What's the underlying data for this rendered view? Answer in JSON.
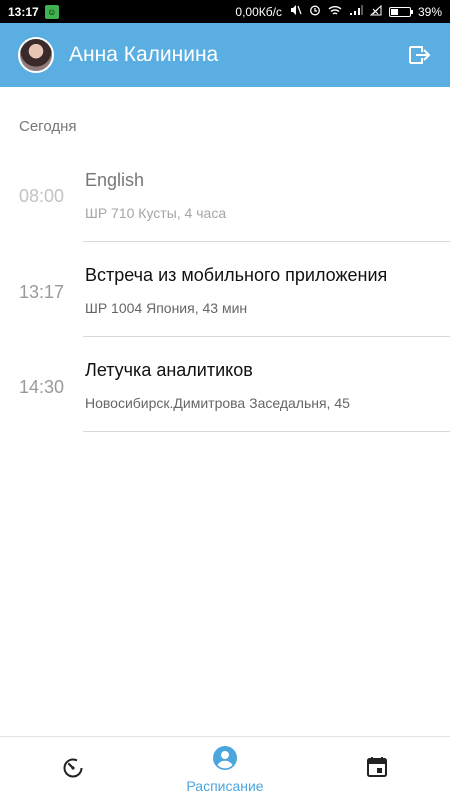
{
  "status_bar": {
    "time": "13:17",
    "network_speed": "0,00Кб/с",
    "battery": "39%",
    "battery_level": 0.39
  },
  "header": {
    "user_name": "Анна Калинина",
    "accent_color": "#5aaee2"
  },
  "schedule": {
    "section_title": "Сегодня",
    "events": [
      {
        "time": "08:00",
        "title": "English",
        "place": "ШР 710 Кусты, 4 часа",
        "state": "past"
      },
      {
        "time": "13:17",
        "title": "Встреча из мобильного приложения",
        "place": "ШР 1004 Япония, 43 мин",
        "state": "current"
      },
      {
        "time": "14:30",
        "title": "Летучка аналитиков",
        "place": "Новосибирск.Димитрова Заседальня, 45",
        "state": "upcoming"
      }
    ]
  },
  "bottom_nav": {
    "items": [
      {
        "icon": "timer-icon",
        "label": ""
      },
      {
        "icon": "account-circle-icon",
        "label": "Расписание",
        "active": true
      },
      {
        "icon": "calendar-icon",
        "label": ""
      }
    ],
    "active_color": "#4aa6dd"
  }
}
